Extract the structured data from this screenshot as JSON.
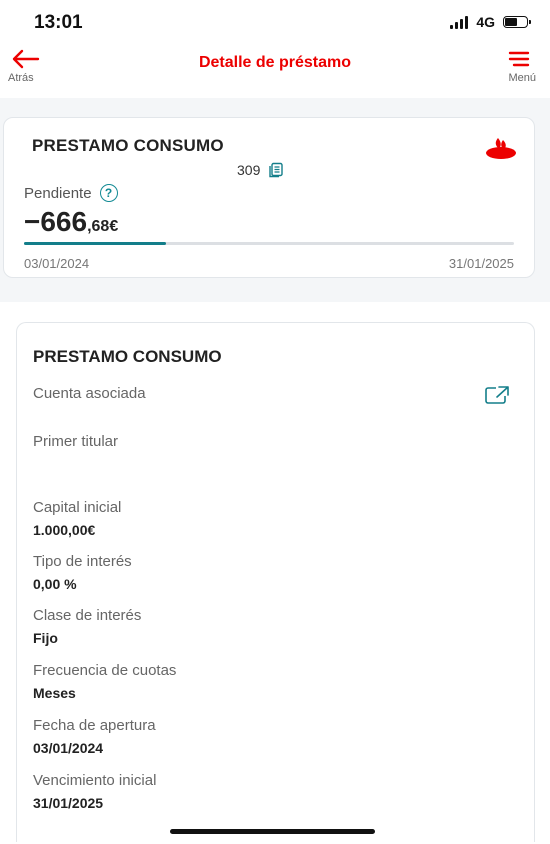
{
  "status_bar": {
    "time": "13:01",
    "network": "4G"
  },
  "nav": {
    "back_label": "Atrás",
    "title": "Detalle de préstamo",
    "menu_label": "Menú"
  },
  "summary": {
    "title": "PRESTAMO CONSUMO",
    "account_fragment": "309",
    "pending_label": "Pendiente",
    "amount_int": "−666",
    "amount_dec": ",68€",
    "progress_fraction": 0.29,
    "start_date": "03/01/2024",
    "end_date": "31/01/2025"
  },
  "details": {
    "title": "PRESTAMO CONSUMO",
    "linked_account_label": "Cuenta asociada",
    "first_holder_label": "Primer titular",
    "initial_capital_label": "Capital inicial",
    "initial_capital_value": "1.000,00€",
    "interest_rate_label": "Tipo de interés",
    "interest_rate_value": "0,00 %",
    "interest_class_label": "Clase de interés",
    "interest_class_value": "Fijo",
    "payment_frequency_label": "Frecuencia de cuotas",
    "payment_frequency_value": "Meses",
    "opening_date_label": "Fecha de apertura",
    "opening_date_value": "03/01/2024",
    "initial_maturity_label": "Vencimiento inicial",
    "initial_maturity_value": "31/01/2025"
  },
  "colors": {
    "brand_red": "#ec0000",
    "teal": "#137e8a"
  }
}
